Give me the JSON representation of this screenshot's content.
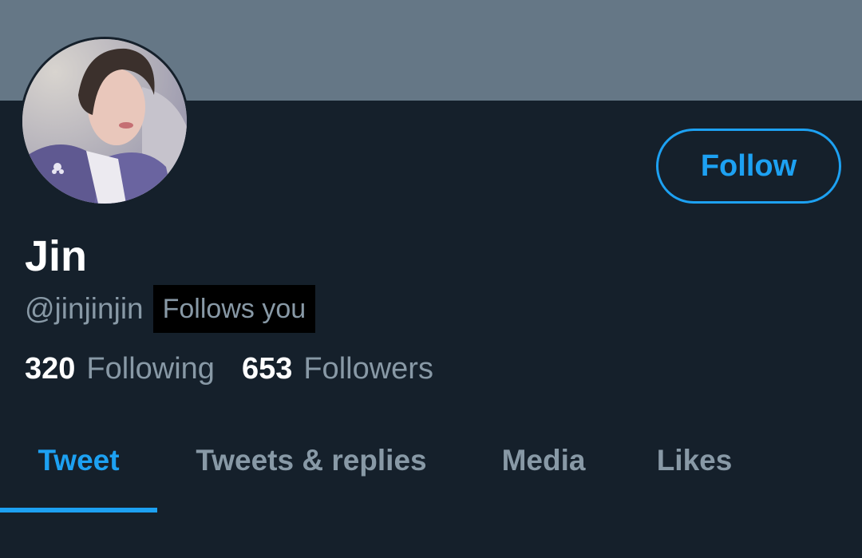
{
  "profile": {
    "name": "Jin",
    "handle": "@jinjinjin",
    "follows_you_badge": "Follows you",
    "follow_button": "Follow",
    "following_count": "320",
    "following_label": "Following",
    "followers_count": "653",
    "followers_label": "Followers"
  },
  "tabs": [
    {
      "label": "Tweet",
      "active": true
    },
    {
      "label": "Tweets & replies",
      "active": false
    },
    {
      "label": "Media",
      "active": false
    },
    {
      "label": "Likes",
      "active": false
    }
  ],
  "colors": {
    "background": "#15202b",
    "banner": "#657786",
    "accent": "#1da1f2",
    "secondary_text": "#8899a6"
  }
}
